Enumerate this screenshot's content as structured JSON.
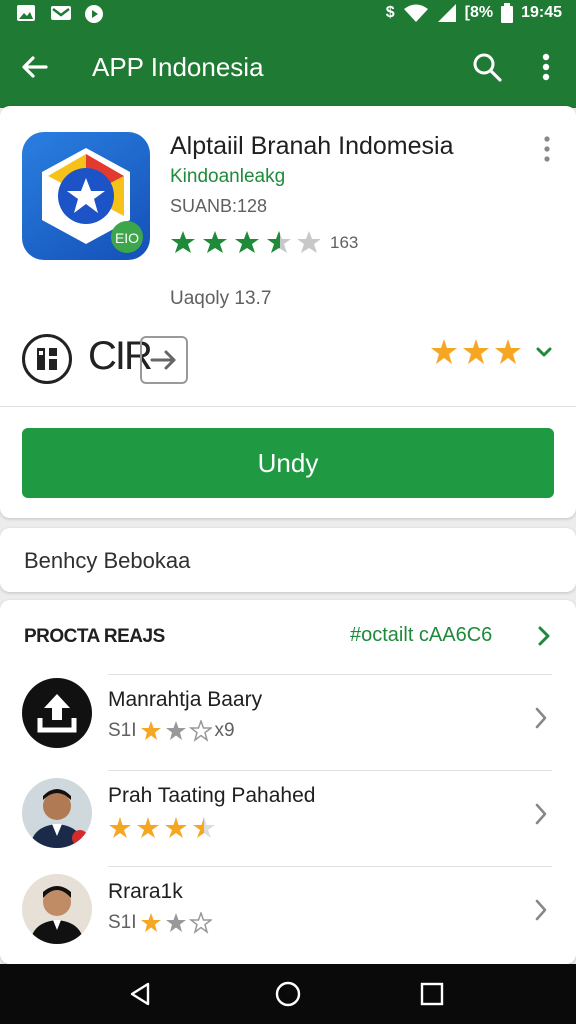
{
  "status_bar": {
    "battery_text": "[8%",
    "time": "19:45",
    "dollar": "$"
  },
  "app_bar": {
    "title": "APP Indonesia",
    "back_icon": "arrow-back-icon",
    "search_icon": "search-icon",
    "more_icon": "more-vert-icon"
  },
  "app_card": {
    "name": "Alptaiil Branah Indomesia",
    "developer": "Kindoanleakg",
    "code": "SUANB:128",
    "rating_count": "163",
    "updated": "Uaqoly 13.7",
    "icon_badge": "EIO",
    "cir_text": "CIR",
    "install_label": "Undy",
    "colors": {
      "primary": "#1f7a33",
      "install": "#1f9a43",
      "star_green": "#1f8a3a",
      "star_orange": "#f5a623"
    }
  },
  "beta_card": {
    "label": "Benhcy Bebokaa"
  },
  "list_card": {
    "section_title": "PROCTA REAJS",
    "see_more": "#octailt cAA6C6",
    "items": [
      {
        "title": "Manrahtja Baary",
        "sub": "S1I",
        "tail": "x9"
      },
      {
        "title": "Prah Taating Pahahed",
        "sub": "",
        "tail": ""
      },
      {
        "title": "Rrara1k",
        "sub": "S1I",
        "tail": ""
      }
    ]
  }
}
